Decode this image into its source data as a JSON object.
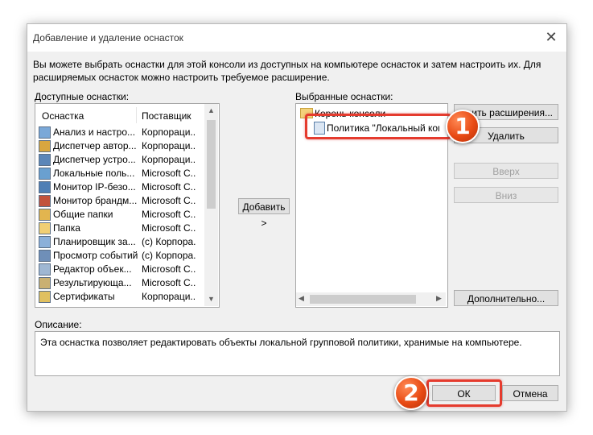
{
  "window": {
    "title": "Добавление и удаление оснасток"
  },
  "description_text": "Вы можете выбрать оснастки для этой консоли из доступных на компьютере оснасток и затем настроить их. Для расширяемых оснасток можно настроить требуемое расширение.",
  "available": {
    "label": "Доступные оснастки:",
    "col_name": "Оснастка",
    "col_vendor": "Поставщик",
    "items": [
      {
        "name": "Анализ и настро...",
        "vendor": "Корпораци...",
        "icon": "analysis-icon"
      },
      {
        "name": "Диспетчер автор...",
        "vendor": "Корпораци...",
        "icon": "authorization-manager-icon"
      },
      {
        "name": "Диспетчер устро...",
        "vendor": "Корпораци...",
        "icon": "device-manager-icon"
      },
      {
        "name": "Локальные поль...",
        "vendor": "Microsoft C...",
        "icon": "local-users-icon"
      },
      {
        "name": "Монитор IP-безо...",
        "vendor": "Microsoft C...",
        "icon": "ip-security-monitor-icon"
      },
      {
        "name": "Монитор брандм...",
        "vendor": "Microsoft C...",
        "icon": "firewall-monitor-icon"
      },
      {
        "name": "Общие папки",
        "vendor": "Microsoft C...",
        "icon": "shared-folders-icon"
      },
      {
        "name": "Папка",
        "vendor": "Microsoft C...",
        "icon": "folder-icon"
      },
      {
        "name": "Планировщик за...",
        "vendor": "(c) Корпора...",
        "icon": "task-scheduler-icon"
      },
      {
        "name": "Просмотр событий",
        "vendor": "(c) Корпора...",
        "icon": "event-viewer-icon"
      },
      {
        "name": "Редактор объек...",
        "vendor": "Microsoft C...",
        "icon": "gpo-editor-icon"
      },
      {
        "name": "Результирующа...",
        "vendor": "Microsoft C...",
        "icon": "rsop-icon"
      },
      {
        "name": "Сертификаты",
        "vendor": "Корпораци...",
        "icon": "certificates-icon"
      }
    ]
  },
  "add_button": "Добавить >",
  "selected": {
    "label": "Выбранные оснастки:",
    "root": "Корень консоли",
    "child": "Политика \"Локальный компь"
  },
  "buttons": {
    "extensions": "ить расширения...",
    "remove": "Удалить",
    "up": "Вверх",
    "down": "Вниз",
    "advanced": "Дополнительно...",
    "ok": "ОК",
    "cancel": "Отмена"
  },
  "description": {
    "label": "Описание:",
    "text": "Эта оснастка позволяет редактировать объекты локальной групповой политики, хранимые на компьютере."
  },
  "badges": {
    "one": "1",
    "two": "2"
  },
  "colors": {
    "highlight": "#e53b2e",
    "badge": "#e84a14"
  }
}
